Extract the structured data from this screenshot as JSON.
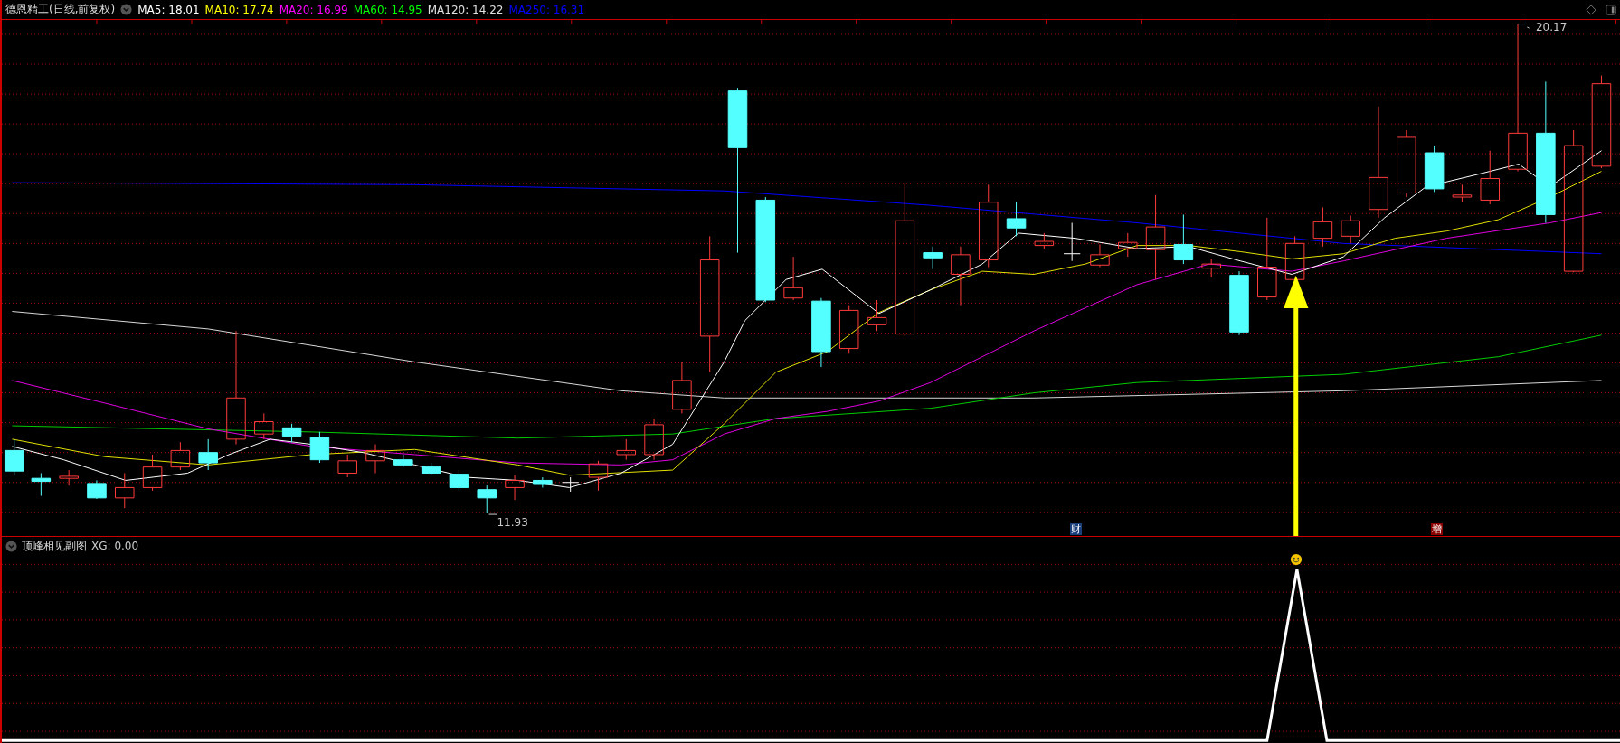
{
  "main_chart": {
    "title": "德恩精工(日线,前复权)",
    "moving_averages": [
      {
        "text": "MA5: 18.01",
        "color": "#ffffff"
      },
      {
        "text": "MA10: 17.74",
        "color": "#ffff00"
      },
      {
        "text": "MA20: 16.99",
        "color": "#ff00ff"
      },
      {
        "text": "MA60: 14.95",
        "color": "#00ff00"
      },
      {
        "text": "MA120: 14.22",
        "color": "#e0e0e0"
      },
      {
        "text": "MA250: 16.31",
        "color": "#0000ff"
      }
    ],
    "high_label": "20.17",
    "low_label": "11.93",
    "markers": [
      {
        "text": "财",
        "color": "#1a3f7a"
      },
      {
        "text": "增",
        "color": "#8b0000"
      }
    ]
  },
  "sub_chart": {
    "title": "顶峰相见副图",
    "value": "XG: 0.00"
  }
}
